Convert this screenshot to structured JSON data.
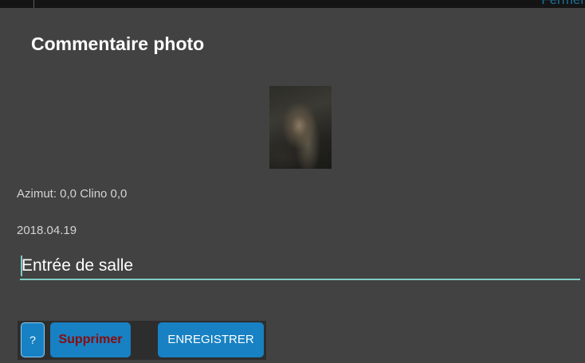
{
  "status_bar": {
    "clipped_text": "Fermer"
  },
  "dialog": {
    "title": "Commentaire photo",
    "photo": {
      "icon": "photo-thumbnail"
    },
    "azimut_line": "Azimut: 0,0 Clino 0,0",
    "date": "2018.04.19",
    "comment": {
      "value": "Entrée de salle",
      "accent_color": "#80cbc4"
    },
    "buttons": {
      "help_label": "?",
      "delete_label": "Supprimer",
      "save_label": "ENREGISTRER"
    },
    "colors": {
      "background": "#424242",
      "button": "#1781c3",
      "delete_text": "#8b0b0b"
    }
  }
}
